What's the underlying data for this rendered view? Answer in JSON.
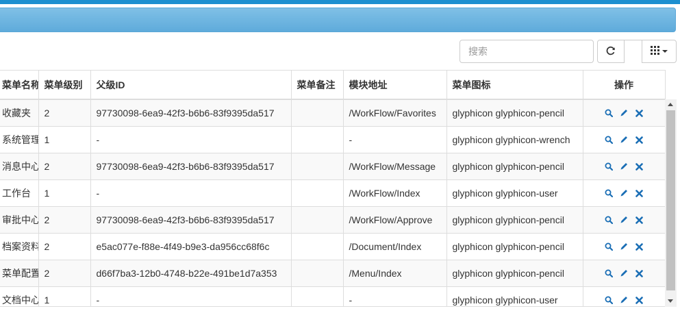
{
  "search": {
    "placeholder": "搜索"
  },
  "toolbar": {
    "refresh_icon": "refresh-icon",
    "columns_icon": "grid-icon"
  },
  "table": {
    "headers": [
      "菜单名称",
      "菜单级别",
      "父级ID",
      "菜单备注",
      "模块地址",
      "菜单图标",
      "操作"
    ],
    "rows": [
      {
        "name": "收藏夹",
        "level": "2",
        "parent": "97730098-6ea9-42f3-b6b6-83f9395da517",
        "remark": "",
        "url": "/WorkFlow/Favorites",
        "icon": "glyphicon glyphicon-pencil"
      },
      {
        "name": "系统管理",
        "level": "1",
        "parent": "-",
        "remark": "",
        "url": "-",
        "icon": "glyphicon glyphicon-wrench"
      },
      {
        "name": "消息中心",
        "level": "2",
        "parent": "97730098-6ea9-42f3-b6b6-83f9395da517",
        "remark": "",
        "url": "/WorkFlow/Message",
        "icon": "glyphicon glyphicon-pencil"
      },
      {
        "name": "工作台",
        "level": "1",
        "parent": "-",
        "remark": "",
        "url": "/WorkFlow/Index",
        "icon": "glyphicon glyphicon-user"
      },
      {
        "name": "审批中心",
        "level": "2",
        "parent": "97730098-6ea9-42f3-b6b6-83f9395da517",
        "remark": "",
        "url": "/WorkFlow/Approve",
        "icon": "glyphicon glyphicon-pencil"
      },
      {
        "name": "档案资料",
        "level": "2",
        "parent": "e5ac077e-f88e-4f49-b9e3-da956cc68f6c",
        "remark": "",
        "url": "/Document/Index",
        "icon": "glyphicon glyphicon-pencil"
      },
      {
        "name": "菜单配置",
        "level": "2",
        "parent": "d66f7ba3-12b0-4748-b22e-491be1d7a353",
        "remark": "",
        "url": "/Menu/Index",
        "icon": "glyphicon glyphicon-pencil"
      },
      {
        "name": "文档中心",
        "level": "1",
        "parent": "-",
        "remark": "",
        "url": "-",
        "icon": "glyphicon glyphicon-user"
      }
    ]
  },
  "colors": {
    "accent": "#1b8fd0",
    "header_bar": "#6db5e1",
    "action_icon": "#1a6eb5"
  }
}
